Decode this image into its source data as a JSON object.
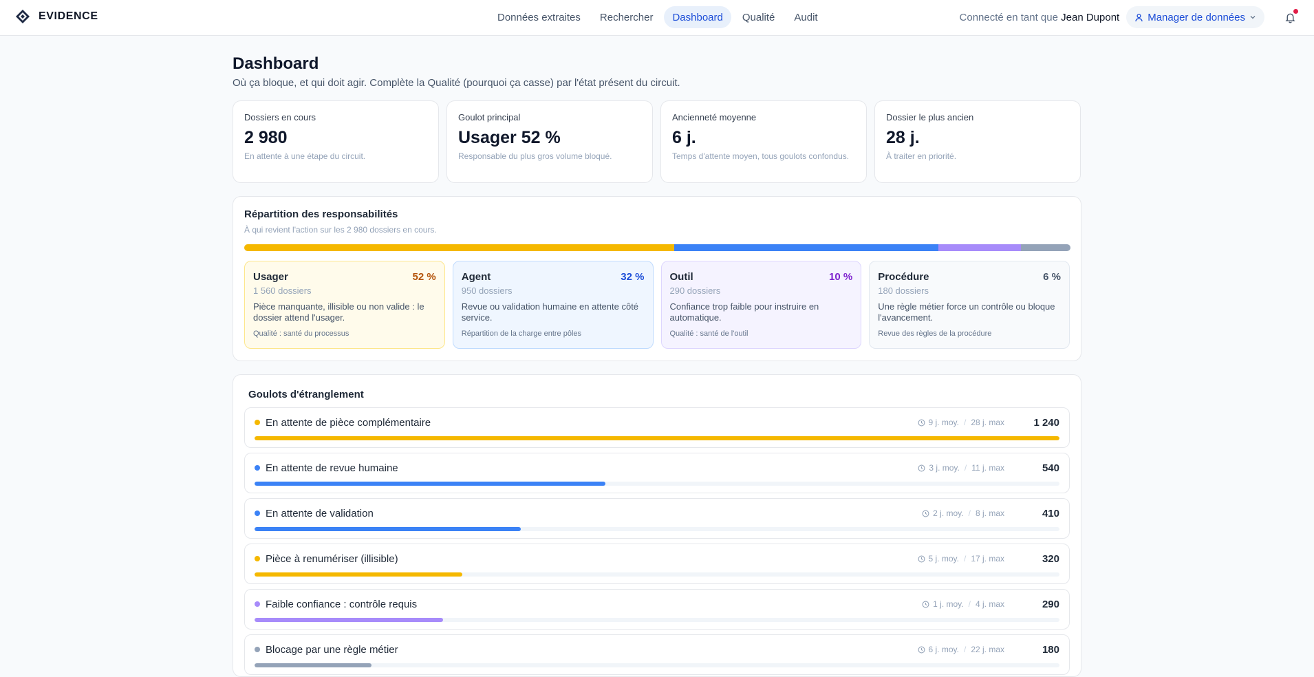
{
  "app": {
    "name": "EVIDENCE"
  },
  "nav": [
    {
      "label": "Données extraites",
      "active": false
    },
    {
      "label": "Rechercher",
      "active": false
    },
    {
      "label": "Dashboard",
      "active": true
    },
    {
      "label": "Qualité",
      "active": false
    },
    {
      "label": "Audit",
      "active": false
    }
  ],
  "user": {
    "connected_prefix": "Connecté en tant que",
    "name": "Jean Dupont",
    "role": "Manager de données",
    "has_notifications": true
  },
  "page": {
    "title": "Dashboard",
    "subtitle": "Où ça bloque, et qui doit agir. Complète la Qualité (pourquoi ça casse) par l'état présent du circuit."
  },
  "kpis": [
    {
      "label": "Dossiers en cours",
      "value": "2 980",
      "note": "En attente à une étape du circuit."
    },
    {
      "label": "Goulot principal",
      "value": "Usager 52 %",
      "note": "Responsable du plus gros volume bloqué."
    },
    {
      "label": "Ancienneté moyenne",
      "value": "6 j.",
      "note": "Temps d'attente moyen, tous goulots confondus."
    },
    {
      "label": "Dossier le plus ancien",
      "value": "28 j.",
      "note": "À traiter en priorité."
    }
  ],
  "responsibilities": {
    "title": "Répartition des responsabilités",
    "subtitle": "À qui revient l'action sur les 2 980 dossiers en cours.",
    "segments": [
      {
        "name": "Usager",
        "pct": "52 %",
        "share": 0.52,
        "count": "1 560 dossiers",
        "desc": "Pièce manquante, illisible ou non valide : le dossier attend l'usager.",
        "link": "Qualité : santé du processus",
        "color": "#f5b800",
        "bg": "#fffbeb",
        "border": "#fde68a",
        "text": "#b45309"
      },
      {
        "name": "Agent",
        "pct": "32 %",
        "share": 0.32,
        "count": "950 dossiers",
        "desc": "Revue ou validation humaine en attente côté service.",
        "link": "Répartition de la charge entre pôles",
        "color": "#3b82f6",
        "bg": "#eff6ff",
        "border": "#bfdbfe",
        "text": "#1d4ed8"
      },
      {
        "name": "Outil",
        "pct": "10 %",
        "share": 0.1,
        "count": "290 dossiers",
        "desc": "Confiance trop faible pour instruire en automatique.",
        "link": "Qualité : santé de l'outil",
        "color": "#a78bfa",
        "bg": "#f5f3ff",
        "border": "#ddd6fe",
        "text": "#7e22ce"
      },
      {
        "name": "Procédure",
        "pct": "6 %",
        "share": 0.06,
        "count": "180 dossiers",
        "desc": "Une règle métier force un contrôle ou bloque l'avancement.",
        "link": "Revue des règles de la procédure",
        "color": "#94a3b8",
        "bg": "#f8fafc",
        "border": "#e2e8f0",
        "text": "#475569"
      }
    ]
  },
  "bottlenecks": {
    "title": "Goulots d'étranglement",
    "rows": [
      {
        "label": "En attente de pièce complémentaire",
        "avg": "9 j. moy.",
        "max": "28 j. max",
        "count": "1 240",
        "value": 1240,
        "color": "#f5b800"
      },
      {
        "label": "En attente de revue humaine",
        "avg": "3 j. moy.",
        "max": "11 j. max",
        "count": "540",
        "value": 540,
        "color": "#3b82f6"
      },
      {
        "label": "En attente de validation",
        "avg": "2 j. moy.",
        "max": "8 j. max",
        "count": "410",
        "value": 410,
        "color": "#3b82f6"
      },
      {
        "label": "Pièce à renumériser (illisible)",
        "avg": "5 j. moy.",
        "max": "17 j. max",
        "count": "320",
        "value": 320,
        "color": "#f5b800"
      },
      {
        "label": "Faible confiance : contrôle requis",
        "avg": "1 j. moy.",
        "max": "4 j. max",
        "count": "290",
        "value": 290,
        "color": "#a78bfa"
      },
      {
        "label": "Blocage par une règle métier",
        "avg": "6 j. moy.",
        "max": "22 j. max",
        "count": "180",
        "value": 180,
        "color": "#94a3b8"
      }
    ]
  }
}
